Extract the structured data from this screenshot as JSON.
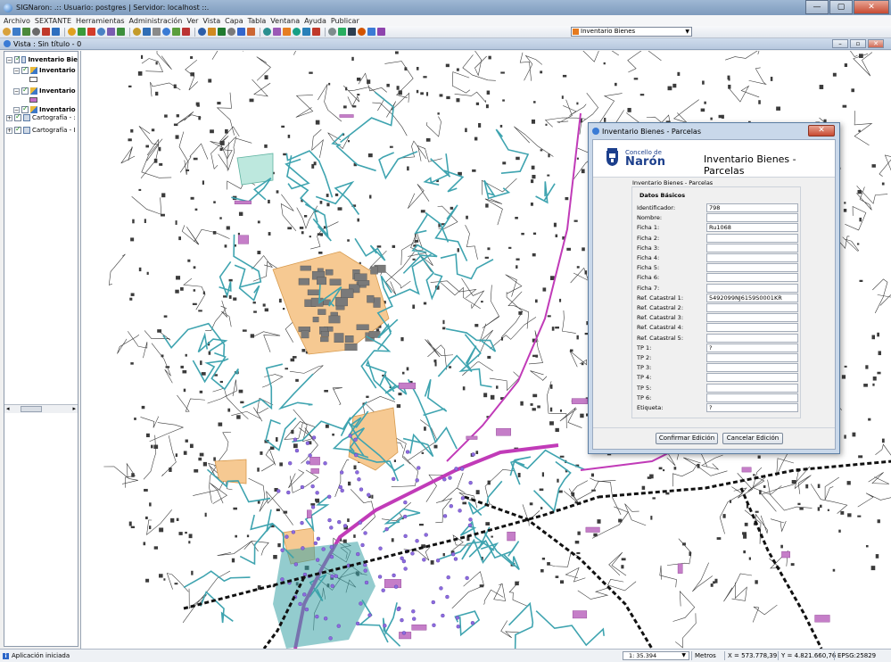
{
  "window": {
    "title": "SIGNaron: .:: Usuario: postgres | Servidor: localhost ::.",
    "minimize": "—",
    "maximize": "▢",
    "close": "✕"
  },
  "menu": [
    "Archivo",
    "SEXTANTE",
    "Herramientas",
    "Administración",
    "Ver",
    "Vista",
    "Capa",
    "Tabla",
    "Ventana",
    "Ayuda",
    "Publicar"
  ],
  "toolbar": {
    "layer_selector": "Inventario Bienes",
    "icon_colors": [
      "#d9a23c",
      "#3d7cc9",
      "#4c8a3a",
      "#6a6a6a",
      "#c0392b",
      "#2e6fbf",
      "#e0a020",
      "#3a9a3a",
      "#d43c2a",
      "#4a82c4",
      "#7a5cb0",
      "#3d8f3d",
      "#c49b2a",
      "#2f6db5",
      "#8a8a8a",
      "#3a7bd5",
      "#5a9e3c",
      "#b33",
      "#2d5ea8",
      "#d08a20",
      "#1f7a2f",
      "#7a7a7a",
      "#3366cc",
      "#cc6633",
      "#2a8f8f",
      "#9b59b6",
      "#e67e22",
      "#16a085",
      "#2980b9",
      "#c0392b",
      "#7f8c8d",
      "#27ae60",
      "#2c3e50",
      "#d35400",
      "#3a7bd5",
      "#8e44ad"
    ]
  },
  "view": {
    "title": "Vista : Sin título - 0"
  },
  "toc": {
    "items": [
      {
        "label": "Inventario Bie",
        "bold": true
      },
      {
        "label": "Inventario",
        "bold": true
      },
      {
        "label": "Inventario",
        "bold": true
      },
      {
        "label": "Inventario",
        "bold": true
      },
      {
        "label": "Cartografía - :",
        "bold": false
      },
      {
        "label": "Cartografía - I",
        "bold": false
      }
    ],
    "scroll_left": "◂",
    "scroll_right": "▸"
  },
  "dialog": {
    "title": "Inventario Bienes - Parcelas",
    "close": "✕",
    "logo_top": "Concello de",
    "logo_main": "Narón",
    "heading": "Inventario Bienes - Parcelas",
    "caption": "Inventario Bienes - Parcelas",
    "section": "Datos Básicos",
    "fields": [
      {
        "label": "Identificador:",
        "value": "798"
      },
      {
        "label": "Nombre:",
        "value": ""
      },
      {
        "label": "Ficha 1:",
        "value": "Ru1068"
      },
      {
        "label": "Ficha 2:",
        "value": ""
      },
      {
        "label": "Ficha 3:",
        "value": ""
      },
      {
        "label": "Ficha 4:",
        "value": ""
      },
      {
        "label": "Ficha 5:",
        "value": ""
      },
      {
        "label": "Ficha 6:",
        "value": ""
      },
      {
        "label": "Ficha 7:",
        "value": ""
      },
      {
        "label": "Ref. Catastral 1:",
        "value": "5492099NJ6159S0001KR"
      },
      {
        "label": "Ref. Catastral 2:",
        "value": ""
      },
      {
        "label": "Ref. Catastral 3:",
        "value": ""
      },
      {
        "label": "Ref. Catastral 4:",
        "value": ""
      },
      {
        "label": "Ref. Catastral 5:",
        "value": ""
      },
      {
        "label": "TP 1:",
        "value": "?"
      },
      {
        "label": "TP 2:",
        "value": ""
      },
      {
        "label": "TP 3:",
        "value": ""
      },
      {
        "label": "TP 4:",
        "value": ""
      },
      {
        "label": "TP 5:",
        "value": ""
      },
      {
        "label": "TP 6:",
        "value": ""
      },
      {
        "label": "Etiqueta:",
        "value": "?"
      }
    ],
    "confirm": "Confirmar Edición",
    "cancel": "Cancelar Edición"
  },
  "status": {
    "message": "Aplicación iniciada",
    "scale": "1: 35.394",
    "units": "Metros",
    "x": "X = 573.778,39",
    "y": "Y = 4.821.660,76",
    "epsg": "EPSG:25829"
  },
  "map_colors": {
    "road": "#3b3b3b",
    "network_cyan": "#3fa4b0",
    "network_magenta": "#c13bb8",
    "parcel_orange": "#f6c992",
    "building": "#7a7a7a",
    "railway": "#111111",
    "point": "#8c6be0"
  }
}
